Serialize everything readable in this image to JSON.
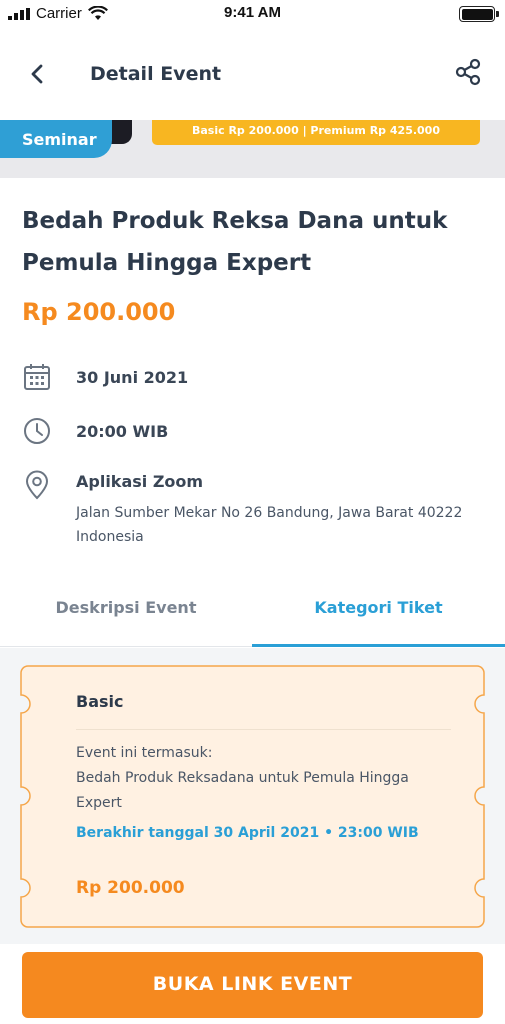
{
  "status_bar": {
    "carrier": "Carrier",
    "time": "9:41 AM"
  },
  "header": {
    "title": "Detail Event",
    "back_icon": "chevron-left-icon",
    "share_icon": "share-icon"
  },
  "banner": {
    "badge": "Seminar",
    "price_strip": "Basic Rp 200.000 | Premium Rp 425.000"
  },
  "event": {
    "title": "Bedah Produk Reksa Dana untuk Pemula Hingga Expert",
    "price": "Rp 200.000",
    "date": "30 Juni 2021",
    "time": "20:00 WIB",
    "location_name": "Aplikasi Zoom",
    "location_address": "Jalan Sumber Mekar No 26 Bandung, Jawa Barat 40222 Indonesia"
  },
  "tabs": [
    {
      "label": "Deskripsi Event",
      "active": false
    },
    {
      "label": "Kategori Tiket",
      "active": true
    }
  ],
  "ticket": {
    "name": "Basic",
    "includes_label": "Event ini termasuk:",
    "includes_item": "Bedah Produk Reksadana untuk Pemula Hingga Expert",
    "deadline": "Berakhir tanggal 30 April 2021 • 23:00 WIB",
    "price": "Rp 200.000"
  },
  "cta": {
    "label": "BUKA LINK EVENT"
  },
  "colors": {
    "accent_orange": "#f5891f",
    "accent_blue": "#2a9fd6",
    "ticket_bg": "#fff1e2",
    "text_dark": "#2d3a4b"
  }
}
